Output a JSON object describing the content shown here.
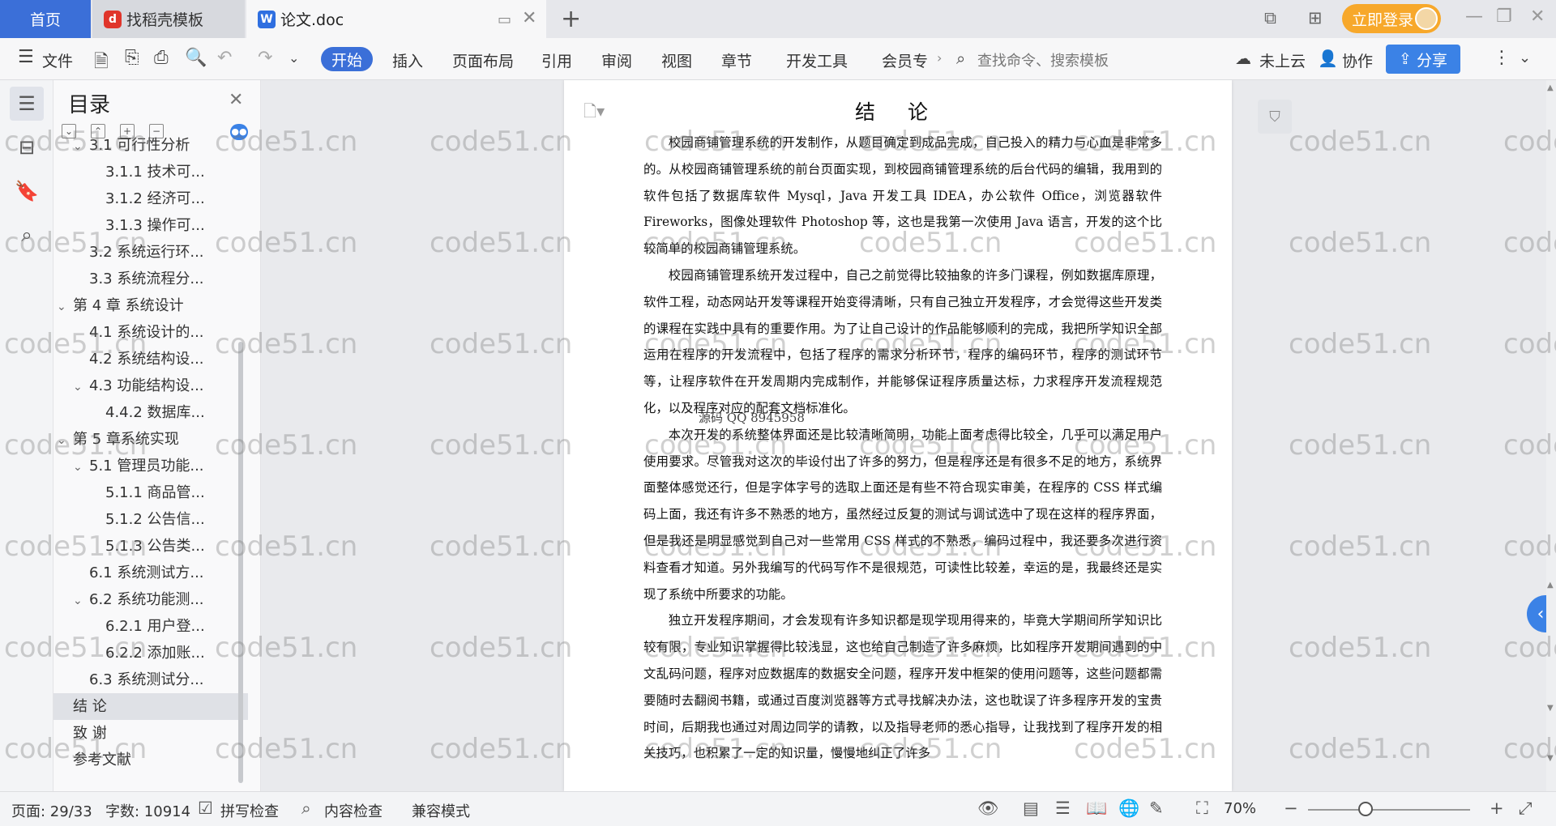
{
  "tabs": {
    "home": "首页",
    "template": "找稻壳模板",
    "doc": "论文.doc"
  },
  "titlebar": {
    "login": "立即登录"
  },
  "ribbon": {
    "file": "文件",
    "start": "开始",
    "insert": "插入",
    "layout": "页面布局",
    "reference": "引用",
    "review": "审阅",
    "view": "视图",
    "chapter": "章节",
    "dev_tools": "开发工具",
    "member": "会员专",
    "search_placeholder": "查找命令、搜索模板",
    "cloud": "未上云",
    "collab": "协作",
    "share": "分享"
  },
  "toc": {
    "title": "目录",
    "items": [
      {
        "label": "3.1 可行性分析",
        "level": 2,
        "expanded": true
      },
      {
        "label": "3.1.1 技术可...",
        "level": 3
      },
      {
        "label": "3.1.2 经济可...",
        "level": 3
      },
      {
        "label": "3.1.3 操作可...",
        "level": 3
      },
      {
        "label": "3.2 系统运行环...",
        "level": 2
      },
      {
        "label": "3.3 系统流程分...",
        "level": 2
      },
      {
        "label": "第 4 章 系统设计",
        "level": 1,
        "expanded": true
      },
      {
        "label": "4.1 系统设计的...",
        "level": 2
      },
      {
        "label": "4.2 系统结构设...",
        "level": 2
      },
      {
        "label": "4.3 功能结构设...",
        "level": 2,
        "expanded": true
      },
      {
        "label": "4.4.2 数据库...",
        "level": 3
      },
      {
        "label": "第 5 章系统实现",
        "level": 1,
        "expanded": true
      },
      {
        "label": "5.1 管理员功能...",
        "level": 2,
        "expanded": true
      },
      {
        "label": "5.1.1 商品管...",
        "level": 3
      },
      {
        "label": "5.1.2 公告信...",
        "level": 3
      },
      {
        "label": "5.1.3 公告类...",
        "level": 3
      },
      {
        "label": "6.1 系统测试方...",
        "level": 2
      },
      {
        "label": "6.2 系统功能测...",
        "level": 2,
        "expanded": true
      },
      {
        "label": "6.2.1 用户登...",
        "level": 3
      },
      {
        "label": "6.2.2 添加账...",
        "level": 3
      },
      {
        "label": "6.3 系统测试分...",
        "level": 2
      },
      {
        "label": "结 论",
        "level": 1,
        "selected": true
      },
      {
        "label": "致 谢",
        "level": 1
      },
      {
        "label": "参考文献",
        "level": 1
      }
    ]
  },
  "document": {
    "title": "结 论",
    "paragraphs": [
      "校园商铺管理系统的开发制作，从题目确定到成品完成，自己投入的精力与心血是非常多的。从校园商铺管理系统的前台页面实现，到校园商铺管理系统的后台代码的编辑，我用到的软件包括了数据库软件 Mysql，Java 开发工具 IDEA，办公软件 Office，浏览器软件 Fireworks，图像处理软件 Photoshop 等，这也是我第一次使用 Java 语言，开发的这个比较简单的校园商铺管理系统。",
      "校园商铺管理系统开发过程中，自己之前觉得比较抽象的许多门课程，例如数据库原理，软件工程，动态网站开发等课程开始变得清晰，只有自己独立开发程序，才会觉得这些开发类的课程在实践中具有的重要作用。为了让自己设计的作品能够顺利的完成，我把所学知识全部运用在程序的开发流程中，包括了程序的需求分析环节，程序的编码环节，程序的测试环节等，让程序软件在开发周期内完成制作，并能够保证程序质量达标，力求程序开发流程规范化，以及程序对应的配套文档标准化。",
      "本次开发的系统整体界面还是比较清晰简明，功能上面考虑得比较全，几乎可以满足用户使用要求。尽管我对这次的毕设付出了许多的努力，但是程序还是有很多不足的地方，系统界面整体感觉还行，但是字体字号的选取上面还是有些不符合现实审美，在程序的 CSS 样式编码上面，我还有许多不熟悉的地方，虽然经过反复的测试与调试选中了现在这样的程序界面，但是我还是明显感觉到自己对一些常用 CSS 样式的不熟悉，编码过程中，我还要多次进行资料查看才知道。另外我编写的代码写作不是很规范，可读性比较差，幸运的是，我最终还是实现了系统中所要求的功能。",
      "独立开发程序期间，才会发现有许多知识都是现学现用得来的，毕竟大学期间所学知识比较有限，专业知识掌握得比较浅显，这也给自己制造了许多麻烦，比如程序开发期间遇到的中文乱码问题，程序对应数据库的数据安全问题，程序开发中框架的使用问题等，这些问题都需要随时去翻阅书籍，或通过百度浏览器等方式寻找解决办法，这也耽误了许多程序开发的宝贵时间，后期我也通过对周边同学的请教，以及指导老师的悉心指导，让我找到了程序开发的相关技巧，也积累了一定的知识量，慢慢地纠正了许多"
    ],
    "stray_text": "源码 QQ 8945958"
  },
  "statusbar": {
    "page": "页面: 29/33",
    "words": "字数: 10914",
    "spell": "拼写检查",
    "content": "内容检查",
    "compat": "兼容模式",
    "zoom": "70%"
  },
  "watermark": "code51.cn"
}
